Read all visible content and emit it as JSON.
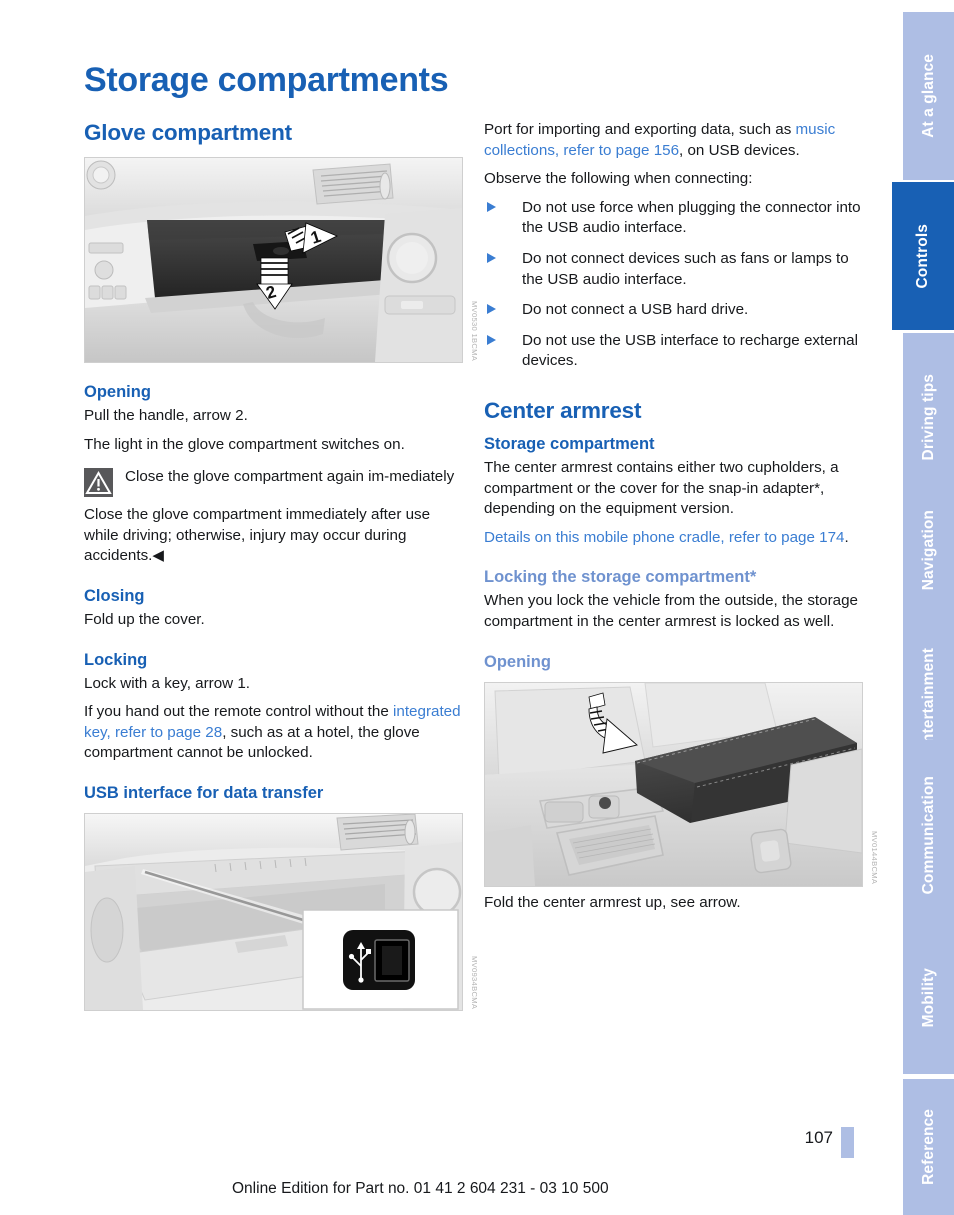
{
  "page_title": "Storage compartments",
  "colors": {
    "heading_blue": "#1860b4",
    "link_blue": "#3a7dd2",
    "tab_inactive": "#aebee4",
    "tab_active": "#1860b4"
  },
  "tabs": [
    {
      "label": "At a glance",
      "active": false
    },
    {
      "label": "Controls",
      "active": true
    },
    {
      "label": "Driving tips",
      "active": false
    },
    {
      "label": "Navigation",
      "active": false
    },
    {
      "label": "Entertainment",
      "active": false
    },
    {
      "label": "Communication",
      "active": false
    },
    {
      "label": "Mobility",
      "active": false
    },
    {
      "label": "Reference",
      "active": false
    }
  ],
  "left_column": {
    "section_title": "Glove compartment",
    "figure_glovebox": {
      "code": "MV0530 1BCMA",
      "callout_1": "1",
      "callout_2": "2"
    },
    "opening": {
      "heading": "Opening",
      "p1": "Pull the handle, arrow 2.",
      "p2": "The light in the glove compartment switches on."
    },
    "warning": {
      "icon": "warning-triangle-icon",
      "title": "Close the glove compartment again im-mediately",
      "body_pre": "Close the glove compartment immediately after use while driving; otherwise, injury may occur during accidents.",
      "endmark": "◀"
    },
    "closing": {
      "heading": "Closing",
      "p1": "Fold up the cover."
    },
    "locking": {
      "heading": "Locking",
      "p1": "Lock with a key, arrow 1.",
      "p2_pre": "If you hand out the remote control without the ",
      "p2_link": "integrated key, refer to page 28",
      "p2_post": ", such as at a hotel, the glove compartment cannot be unlocked."
    },
    "usb": {
      "heading": "USB interface for data transfer",
      "figure_code": "MV0934BCMA"
    }
  },
  "right_column": {
    "usb_intro": {
      "p1_pre": "Port for importing and exporting data, such as ",
      "p1_link": "music collections, refer to page 156",
      "p1_post": ", on USB devices.",
      "p2": "Observe the following when connecting:"
    },
    "usb_bullets": [
      "Do not use force when plugging the connector into the USB audio interface.",
      "Do not connect devices such as fans or lamps to the USB audio interface.",
      "Do not connect a USB hard drive.",
      "Do not use the USB interface to recharge external devices."
    ],
    "section_title": "Center armrest",
    "storage_compartment": {
      "heading": "Storage compartment",
      "p1": "The center armrest contains either two cupholders, a compartment or the cover for the snap-in adapter*, depending on the equipment version.",
      "p2_link": "Details on this mobile phone cradle, refer to page 174",
      "p2_post": "."
    },
    "locking_storage": {
      "heading": "Locking the storage compartment*",
      "p1": "When you lock the vehicle from the outside, the storage compartment in the center armrest is locked as well."
    },
    "opening": {
      "heading": "Opening",
      "figure_code": "MV0144BCMA",
      "caption": "Fold the center armrest up, see arrow."
    }
  },
  "footer": {
    "page_number": "107",
    "note": "Online Edition for Part no. 01 41 2 604 231 - 03 10 500"
  }
}
